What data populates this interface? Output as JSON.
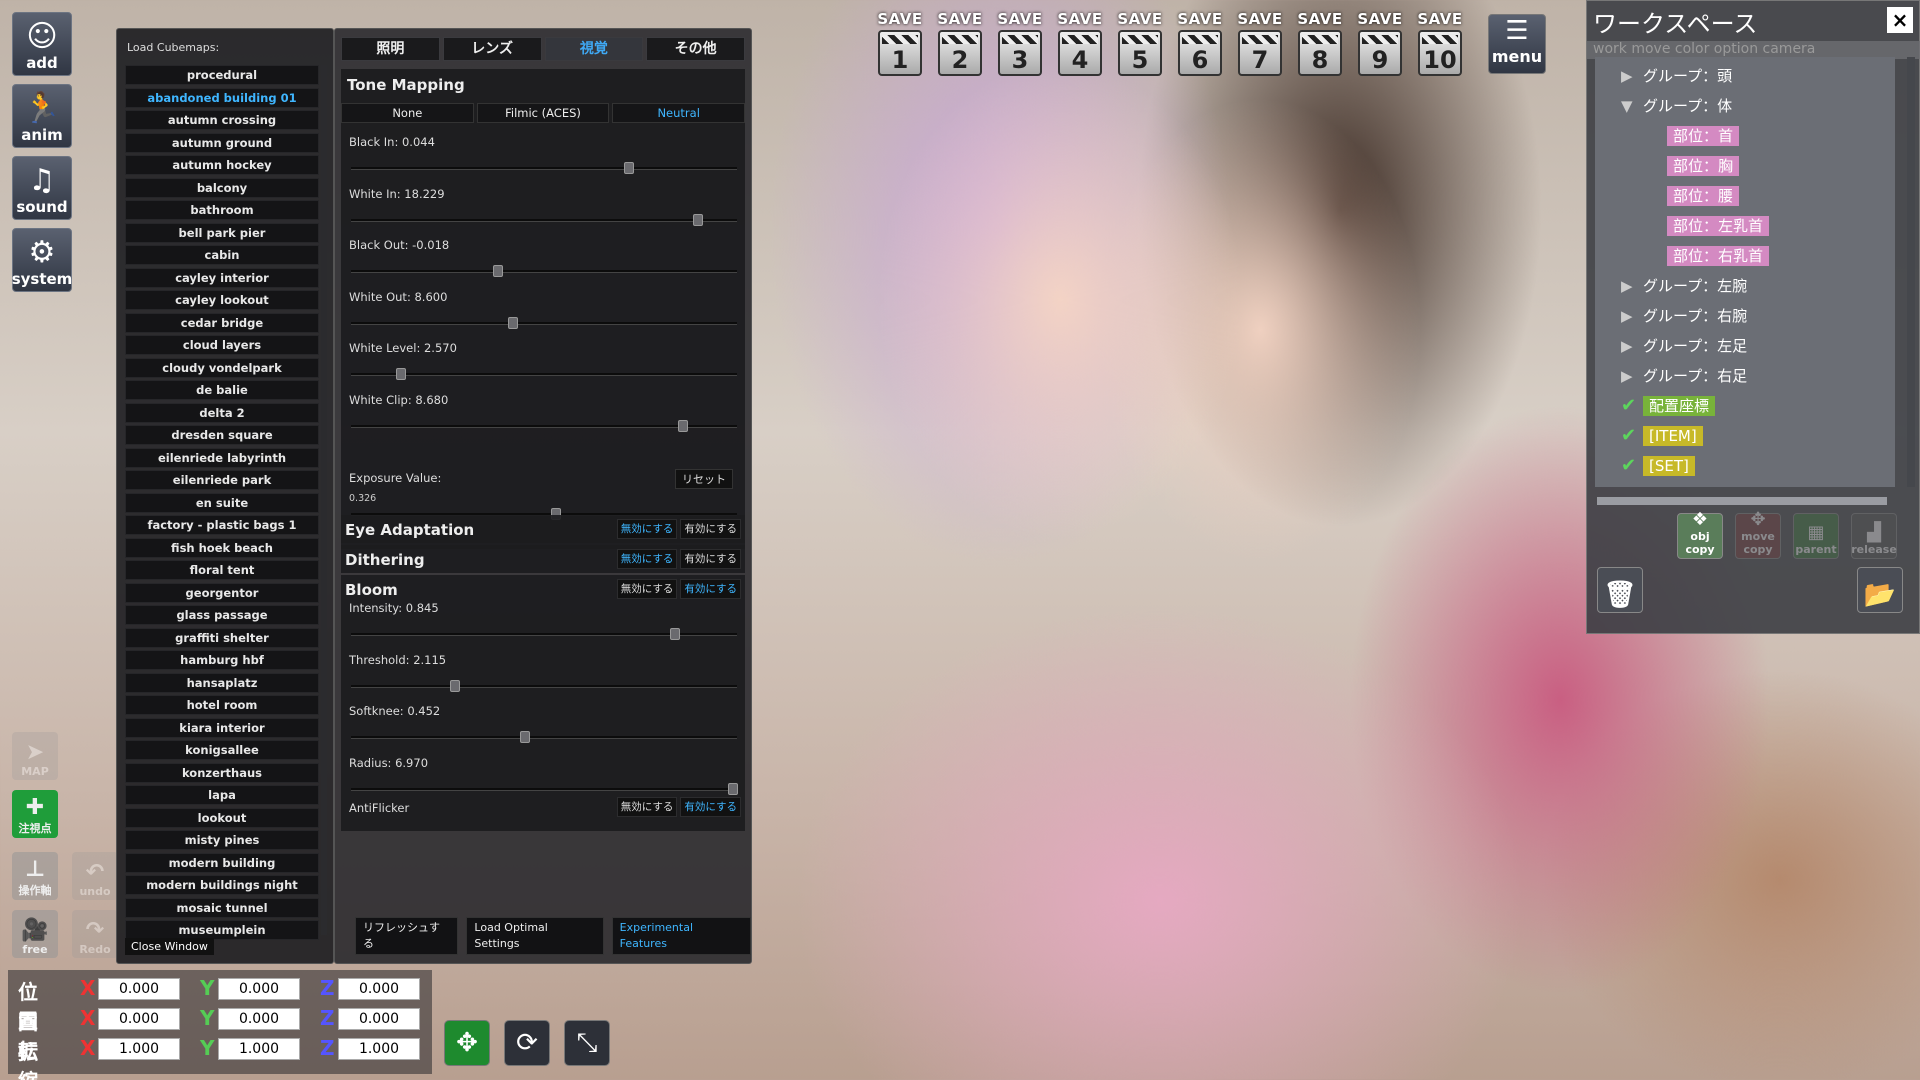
{
  "left_toolbar": {
    "add": "add",
    "anim": "anim",
    "sound": "sound",
    "system": "system",
    "map": "MAP",
    "gaze": "注視点",
    "axis": "操作軸",
    "undo": "undo",
    "free": "free",
    "redo": "Redo"
  },
  "cubemaps": {
    "header": "Load Cubemaps:",
    "selected": "abandoned building 01",
    "items": [
      "procedural",
      "abandoned building 01",
      "autumn crossing",
      "autumn ground",
      "autumn hockey",
      "balcony",
      "bathroom",
      "bell park pier",
      "cabin",
      "cayley interior",
      "cayley lookout",
      "cedar bridge",
      "cloud layers",
      "cloudy vondelpark",
      "de balie",
      "delta 2",
      "dresden square",
      "eilenriede labyrinth",
      "eilenriede park",
      "en suite",
      "factory - plastic bags 1",
      "fish hoek beach",
      "floral tent",
      "georgentor",
      "glass passage",
      "graffiti shelter",
      "hamburg hbf",
      "hansaplatz",
      "hotel room",
      "kiara interior",
      "konigsallee",
      "konzerthaus",
      "lapa",
      "lookout",
      "misty pines",
      "modern building",
      "modern buildings night",
      "mosaic tunnel",
      "museumplein"
    ],
    "close": "Close Window"
  },
  "tabs": [
    "照明",
    "レンズ",
    "視覚",
    "その他"
  ],
  "selected_tab": "視覚",
  "tone_mapping": {
    "title": "Tone Mapping",
    "modes": [
      "None",
      "Filmic (ACES)",
      "Neutral"
    ],
    "selected_mode": "Neutral",
    "sliders": [
      {
        "label": "Black In: 0.044",
        "pos": 0.72
      },
      {
        "label": "White In: 18.229",
        "pos": 0.9
      },
      {
        "label": "Black Out: -0.018",
        "pos": 0.38
      },
      {
        "label": "White Out: 8.600",
        "pos": 0.42
      },
      {
        "label": "White Level: 2.570",
        "pos": 0.13
      },
      {
        "label": "White Clip: 8.680",
        "pos": 0.86
      }
    ],
    "exposure": {
      "label": "Exposure Value:",
      "value": "0.326",
      "reset": "リセット",
      "pos": 0.53
    }
  },
  "toggle_labels": {
    "off": "無効にする",
    "on": "有効にする"
  },
  "eye_adaptation": {
    "title": "Eye Adaptation",
    "state": "off"
  },
  "dithering": {
    "title": "Dithering",
    "state": "off"
  },
  "bloom": {
    "title": "Bloom",
    "state": "on",
    "sliders": [
      {
        "label": "Intensity: 0.845",
        "pos": 0.84
      },
      {
        "label": "Threshold: 2.115",
        "pos": 0.27
      },
      {
        "label": "Softknee: 0.452",
        "pos": 0.45
      },
      {
        "label": "Radius: 6.970",
        "pos": 0.99
      }
    ],
    "antiflicker": {
      "label": "AntiFlicker",
      "state": "on"
    }
  },
  "bottom_buttons": {
    "refresh": "リフレッシュする",
    "optimal": "Load Optimal Settings",
    "experimental": "Experimental Features"
  },
  "save_slots": {
    "label": "SAVE",
    "numbers": [
      "1",
      "2",
      "3",
      "4",
      "5",
      "6",
      "7",
      "8",
      "9",
      "10"
    ]
  },
  "menu": "menu",
  "workspace": {
    "title": "ワークスペース",
    "close": "×",
    "hidden_row": "work   move   color   option   camera",
    "tree": [
      {
        "text": "グループ：頭",
        "kind": "group",
        "open": false
      },
      {
        "text": "グループ：体",
        "kind": "group",
        "open": true
      },
      {
        "text": "部位：首",
        "kind": "part"
      },
      {
        "text": "部位：胸",
        "kind": "part"
      },
      {
        "text": "部位：腰",
        "kind": "part"
      },
      {
        "text": "部位：左乳首",
        "kind": "part"
      },
      {
        "text": "部位：右乳首",
        "kind": "part"
      },
      {
        "text": "グループ：左腕",
        "kind": "group",
        "open": false
      },
      {
        "text": "グループ：右腕",
        "kind": "group",
        "open": false
      },
      {
        "text": "グループ：左足",
        "kind": "group",
        "open": false
      },
      {
        "text": "グループ：右足",
        "kind": "group",
        "open": false
      },
      {
        "text": "配置座標",
        "kind": "checked",
        "color": "green"
      },
      {
        "text": "[ITEM]",
        "kind": "checked",
        "color": "yellow"
      },
      {
        "text": "[SET]",
        "kind": "checked",
        "color": "yellow"
      }
    ],
    "icons": {
      "obj_copy": "obj copy",
      "move_copy": "move copy",
      "parent": "parent",
      "release": "release"
    }
  },
  "transform": {
    "rows": [
      {
        "label": "位置",
        "x": "0.000",
        "y": "0.000",
        "z": "0.000"
      },
      {
        "label": "回転",
        "x": "0.000",
        "y": "0.000",
        "z": "0.000"
      },
      {
        "label": "拡縮",
        "x": "1.000",
        "y": "1.000",
        "z": "1.000"
      }
    ],
    "axis_letters": {
      "x": "X",
      "y": "Y",
      "z": "Z"
    }
  }
}
